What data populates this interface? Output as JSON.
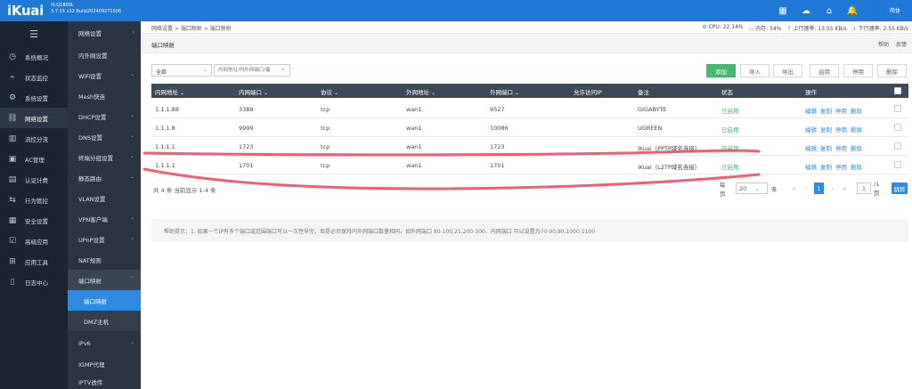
{
  "header": {
    "logo": "iKuai",
    "model": "IK-Q1800L",
    "version": "3.7.15 x32 Build202409271506",
    "icons": [
      "grid-icon",
      "cloud-icon",
      "home-icon",
      "bell-icon",
      "user-icon"
    ],
    "lang": "简体"
  },
  "primary_nav": {
    "items": [
      {
        "icon": "dashboard-icon",
        "label": "系统概况"
      },
      {
        "icon": "monitor-icon",
        "label": "状态监控"
      },
      {
        "icon": "gear-icon",
        "label": "系统设置"
      },
      {
        "icon": "network-icon",
        "label": "网络设置",
        "active": true
      },
      {
        "icon": "flow-icon",
        "label": "流控分流"
      },
      {
        "icon": "ac-icon",
        "label": "AC管理"
      },
      {
        "icon": "auth-icon",
        "label": "认证计费"
      },
      {
        "icon": "behavior-icon",
        "label": "行为管控"
      },
      {
        "icon": "shield-icon",
        "label": "安全设置"
      },
      {
        "icon": "advanced-icon",
        "label": "高级应用"
      },
      {
        "icon": "apps-icon",
        "label": "应用工具"
      },
      {
        "icon": "log-icon",
        "label": "日志中心"
      }
    ]
  },
  "secondary_nav": {
    "title": "网络设置",
    "items": [
      {
        "label": "内外网设置"
      },
      {
        "label": "WiFi设置"
      },
      {
        "label": "Mesh快连"
      },
      {
        "label": "DHCP设置"
      },
      {
        "label": "DNS设置"
      },
      {
        "label": "终端分组设置"
      },
      {
        "label": "静态路由"
      },
      {
        "label": "VLAN设置"
      },
      {
        "label": "VPN客户端"
      },
      {
        "label": "UPnP设置"
      },
      {
        "label": "NAT规则"
      },
      {
        "label": "端口映射"
      }
    ],
    "sub_items": [
      {
        "label": "端口映射",
        "active": true
      },
      {
        "label": "DMZ主机"
      }
    ],
    "more_items": [
      {
        "label": "IPv6"
      },
      {
        "label": "IGMP代理"
      },
      {
        "label": "IPTV透传"
      }
    ]
  },
  "breadcrumb": "网络设置 > 端口映射 > 端口映射",
  "stats": {
    "cpu": "CPU: 22.14%",
    "memory": "内存: 54%",
    "upload": "上行速率: 13.55 KB/s",
    "download": "下行速率: 2.55 KB/s"
  },
  "page_title": "端口映射",
  "help_links": [
    "帮助",
    "反馈"
  ],
  "toolbar": {
    "filter_value": "全部",
    "search_placeholder": "内网地址/内外网端口/备",
    "buttons": [
      "添加",
      "导入",
      "导出",
      "启用",
      "停用",
      "删除"
    ]
  },
  "table": {
    "columns": [
      "内网地址",
      "内网端口",
      "协议",
      "外网地址",
      "外网端口",
      "允许访问IP",
      "备注",
      "状态",
      "操作"
    ],
    "rows": [
      {
        "lan_ip": "1.1.1.88",
        "lan_port": "3389",
        "proto": "tcp",
        "wan": "wan1",
        "wan_port": "9527",
        "allow": "",
        "note": "GIGABYTE",
        "status": "已启用"
      },
      {
        "lan_ip": "1.1.1.8",
        "lan_port": "9999",
        "proto": "tcp",
        "wan": "wan1",
        "wan_port": "10086",
        "allow": "",
        "note": "UGREEN",
        "status": "已启用"
      },
      {
        "lan_ip": "1.1.1.1",
        "lan_port": "1723",
        "proto": "tcp",
        "wan": "wan1",
        "wan_port": "1723",
        "allow": "",
        "note": "iKuai（PPTP域名连接）",
        "status": "已启用"
      },
      {
        "lan_ip": "1.1.1.1",
        "lan_port": "1701",
        "proto": "tcp",
        "wan": "wan1",
        "wan_port": "1701",
        "allow": "",
        "note": "iKuai（L2TP域名连接）",
        "status": "已启用"
      }
    ],
    "ops": [
      "编辑",
      "复制",
      "停用",
      "删除"
    ]
  },
  "footer": {
    "total": "共 4 条 当前显示 1-4 条",
    "per_page_label": "每页",
    "per_page_value": "20",
    "per_page_unit": "条",
    "current_page": "1",
    "goto_value": "1",
    "total_pages": "/1页",
    "jump_label": "跳转"
  },
  "tips": "帮助提示：1. 如果一个IP有多个端口或范围端口可以一次性导完，但是必须保持内外网端口数量相同，如外网端口 80-100,21,200-300、内网端口 可以设置为70-90,80,1000-1100",
  "annotation_color": "#e8455a"
}
